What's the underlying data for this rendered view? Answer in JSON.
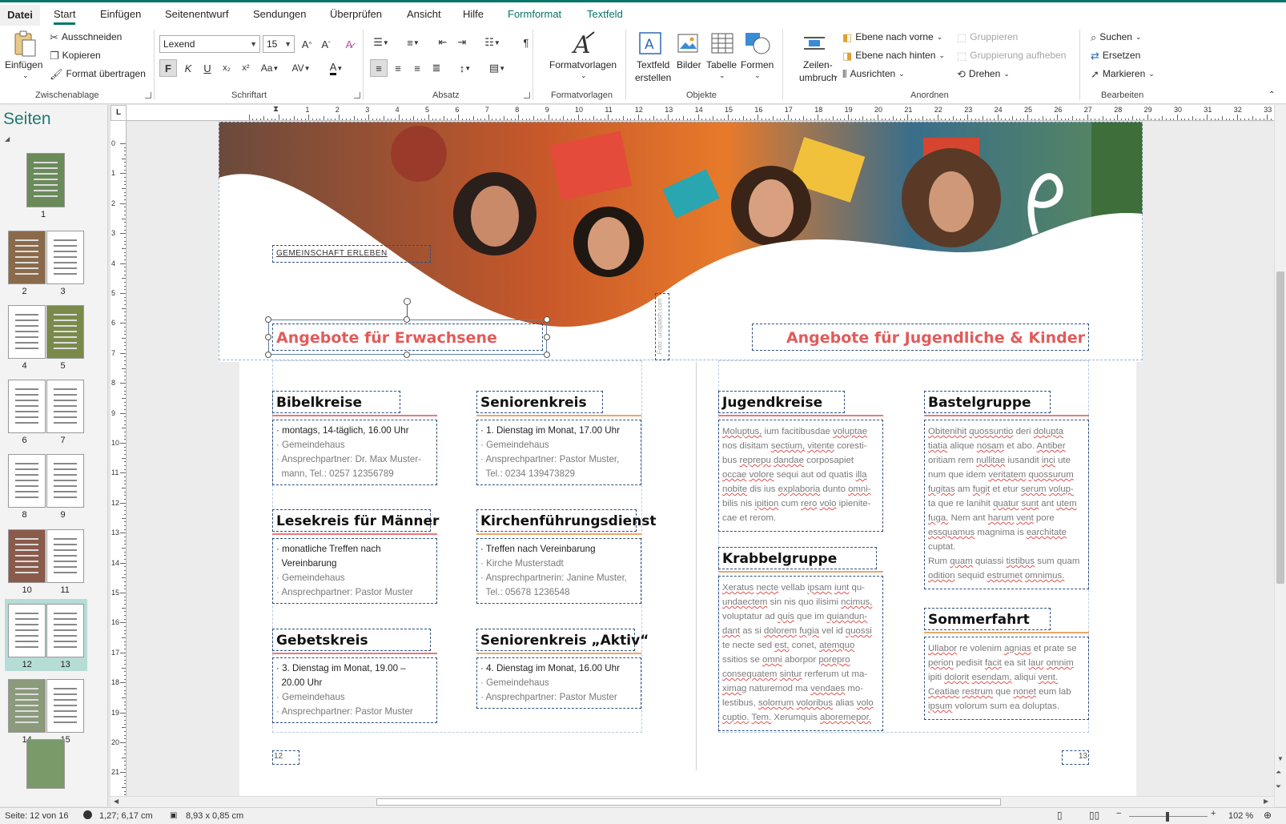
{
  "menu": {
    "items": [
      "Datei",
      "Start",
      "Einfügen",
      "Seitenentwurf",
      "Sendungen",
      "Überprüfen",
      "Ansicht",
      "Hilfe",
      "Formformat",
      "Textfeld"
    ],
    "active": "Start"
  },
  "ribbon": {
    "clipboard": {
      "paste": "Einfügen",
      "cut": "Ausschneiden",
      "copy": "Kopieren",
      "format_painter": "Format übertragen",
      "label": "Zwischenablage"
    },
    "font": {
      "family": "Lexend",
      "size": "15",
      "bold": "F",
      "italic": "K",
      "underline": "U",
      "subscript": "x₂",
      "superscript": "x²",
      "case": "Aa",
      "spacing": "AV",
      "color_letter": "A",
      "label": "Schriftart"
    },
    "paragraph": {
      "label": "Absatz"
    },
    "styles": {
      "button": "Formatvorlagen",
      "label": "Formatvorlagen"
    },
    "objects": {
      "textbox1": "Textfeld",
      "textbox2": "erstellen",
      "pictures": "Bilder",
      "table": "Tabelle",
      "shapes": "Formen",
      "label": "Objekte"
    },
    "arrange": {
      "wrap1": "Zeilen-",
      "wrap2": "umbruch",
      "bring_forward": "Ebene nach vorne",
      "send_backward": "Ebene nach hinten",
      "align": "Ausrichten",
      "group": "Gruppieren",
      "ungroup": "Gruppierung aufheben",
      "rotate": "Drehen",
      "label": "Anordnen"
    },
    "editing": {
      "find": "Suchen",
      "replace": "Ersetzen",
      "select": "Markieren",
      "label": "Bearbeiten"
    }
  },
  "sidebar": {
    "title": "Seiten",
    "pages": [
      "1",
      "2",
      "3",
      "4",
      "5",
      "6",
      "7",
      "8",
      "9",
      "10",
      "11",
      "12",
      "13",
      "14",
      "15"
    ]
  },
  "ruler": {
    "h_ticks": [
      "1",
      "2",
      "3",
      "4",
      "5",
      "6",
      "7",
      "8",
      "9",
      "10",
      "11",
      "12",
      "13",
      "14",
      "15",
      "16",
      "17",
      "18",
      "19",
      "20",
      "21",
      "22",
      "23",
      "24",
      "25",
      "26",
      "27",
      "28",
      "29",
      "30",
      "31",
      "32",
      "33"
    ],
    "v_ticks": [
      "0",
      "1",
      "2",
      "3",
      "4",
      "5",
      "6",
      "7",
      "8",
      "9",
      "10",
      "11",
      "12",
      "13",
      "14",
      "15",
      "16",
      "17",
      "18",
      "19",
      "20",
      "21"
    ]
  },
  "document": {
    "kicker": "Gemeinschaft erleben",
    "photo_credit": "Foto: unsplash.com",
    "left_title": "Angebote für Erwachsene",
    "right_title": "Angebote für Jugendliche & Kinder",
    "sections": [
      {
        "title": "Bibelkreise",
        "lines": [
          "· montags, 14-täglich, 16.00 Uhr",
          "· Gemeindehaus",
          "· Ansprechpartner: Dr. Max Muster-",
          "  mann, Tel.: 0257 12356789"
        ]
      },
      {
        "title": "Seniorenkreis",
        "lines": [
          "· 1. Dienstag im Monat, 17.00 Uhr",
          "· Gemeindehaus",
          "· Ansprechpartner: Pastor Muster,",
          "  Tel.: 0234 139473829"
        ]
      },
      {
        "title": "Lesekreis für Männer",
        "lines": [
          "· monatliche Treffen nach",
          "  Vereinbarung",
          "· Gemeindehaus",
          "· Ansprechpartner: Pastor Muster"
        ]
      },
      {
        "title": "Kirchenführungsdienst",
        "lines": [
          "· Treffen nach Vereinbarung",
          "· Kirche Musterstadt",
          "· Ansprechpartnerin: Janine Muster,",
          "  Tel.: 05678 1236548"
        ]
      },
      {
        "title": "Gebetskreis",
        "lines": [
          "· 3. Dienstag im Monat, 19.00 –",
          "  20.00 Uhr",
          "· Gemeindehaus",
          "· Ansprechpartner: Pastor Muster"
        ]
      },
      {
        "title": "Seniorenkreis „Aktiv“",
        "lines": [
          "· 4. Dienstag im Monat, 16.00 Uhr",
          "· Gemeindehaus",
          "· Ansprechpartner: Pastor Muster"
        ]
      }
    ],
    "right_sections": [
      {
        "title": "Jugendkreise",
        "lines": [
          "Moluptus, ium facitibusdae voluptae",
          "nos disitam sectium, vitente coresti-",
          "bus reprepu dandae corposapiet",
          "occae volore sequi aut od quatis illa",
          "nobite dis ius explaboria dunto omni-",
          "bilis nis ipition cum rero volo ipienite-",
          "cae et rerom."
        ]
      },
      {
        "title": "Krabbelgruppe",
        "lines": [
          "Xeratus necte vellab ipsam iunt qu-",
          "undaectem sin nis quo ilisimi ncimus,",
          "voluptatur ad quis que im quiandun-",
          "dant as si dolorem fugia vel id quossi",
          "te necte sed est, conet, atemquo",
          "ssitios se omni aborpor porepro",
          "consequatem sintur rerferum ut ma-",
          "ximag naturemod ma vendaes mo-",
          "lestibus, solorrum voloribus alias volo",
          "cuptio. Tem. Xerumquis aboremepor."
        ]
      },
      {
        "title": "Bastelgruppe",
        "lines": [
          "Obitenihit quossuntio deri dolupta",
          "tiatia alique nosam et abo. Antiber",
          "oritiam rem nullitae iusandit inci ute",
          "num que idem veritatem quossurum",
          "fugitas am fugit et etur serum volup-",
          "ta que re lanihit quatur sunt ant utem",
          "fuga. Nem ant harum vent pore",
          "essquamus magnima is earchitate",
          "cuptat.",
          "Rum quam quiassi tistibus sum quam",
          "odition sequid estrumet omnimus."
        ]
      },
      {
        "title": "Sommerfahrt",
        "lines": [
          "Ullabor re volenim agnias et prate se",
          "perion pedisit facit ea sit laur omnim",
          "ipiti dolorit esendam, aliqui vent.",
          "Ceatiae restrum que nonet eum lab",
          "ipsum volorum sum ea doluptas."
        ]
      }
    ],
    "page_left": "12",
    "page_right": "13"
  },
  "status": {
    "page": "Seite: 12 von 16",
    "position": "1,27; 6,17 cm",
    "size": "8,93 x  0,85 cm",
    "zoom": "102 %"
  },
  "colors": {
    "accent": "#077568",
    "title_red": "#e35a5a",
    "line_orange": "#e9a86a",
    "line_red": "#e67a7a"
  }
}
